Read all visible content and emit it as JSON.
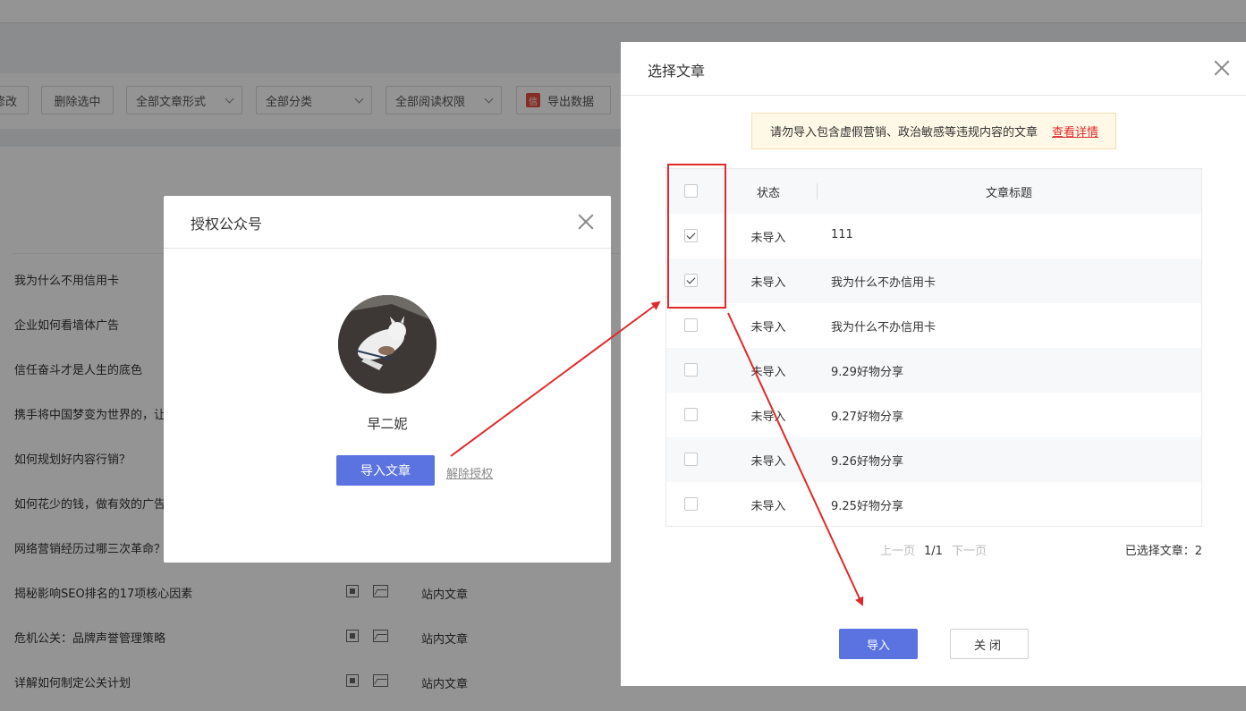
{
  "toolbar": {
    "edit_label": "修改",
    "delete_label": "删除选中",
    "form_select": "全部文章形式",
    "category_select": "全部分类",
    "permission_select": "全部阅读权限",
    "export_icon_text": "信",
    "export_label": "导出数据"
  },
  "background_list": [
    {
      "title": "我为什么不用信用卡"
    },
    {
      "title": "企业如何看墙体广告"
    },
    {
      "title": "信任奋斗才是人生的底色"
    },
    {
      "title": "携手将中国梦变为世界的，让"
    },
    {
      "title": "如何规划好内容行销？"
    },
    {
      "title": "如何花少的钱，做有效的广告"
    },
    {
      "title": "网络营销经历过哪三次革命？"
    },
    {
      "title": "揭秘影响SEO排名的17项核心因素",
      "category": "站内文章"
    },
    {
      "title": "危机公关：品牌声誉管理策略",
      "category": "站内文章"
    },
    {
      "title": "详解如何制定公关计划",
      "category": "站内文章"
    }
  ],
  "auth_dialog": {
    "title": "授权公众号",
    "account_name": "早二妮",
    "import_button": "导入文章",
    "unauthorize_link": "解除授权"
  },
  "select_dialog": {
    "title": "选择文章",
    "notice_text": "请勿导入包含虚假营销、政治敏感等违规内容的文章",
    "notice_link": "查看详情",
    "columns": {
      "status": "状态",
      "title": "文章标题"
    },
    "rows": [
      {
        "checked": true,
        "status": "未导入",
        "title": "111"
      },
      {
        "checked": true,
        "status": "未导入",
        "title": "我为什么不办信用卡"
      },
      {
        "checked": false,
        "status": "未导入",
        "title": "我为什么不办信用卡"
      },
      {
        "checked": false,
        "status": "未导入",
        "title": "9.29好物分享"
      },
      {
        "checked": false,
        "status": "未导入",
        "title": "9.27好物分享"
      },
      {
        "checked": false,
        "status": "未导入",
        "title": "9.26好物分享"
      },
      {
        "checked": false,
        "status": "未导入",
        "title": "9.25好物分享"
      }
    ],
    "pager": {
      "prev": "上一页",
      "current": "1/1",
      "next": "下一页"
    },
    "selected_count": "已选择文章：2",
    "import_button": "导入",
    "close_button": "关闭"
  },
  "colors": {
    "primary": "#5b73e0",
    "annotation_red": "#e0292b",
    "notice_bg": "#fff8e6"
  }
}
